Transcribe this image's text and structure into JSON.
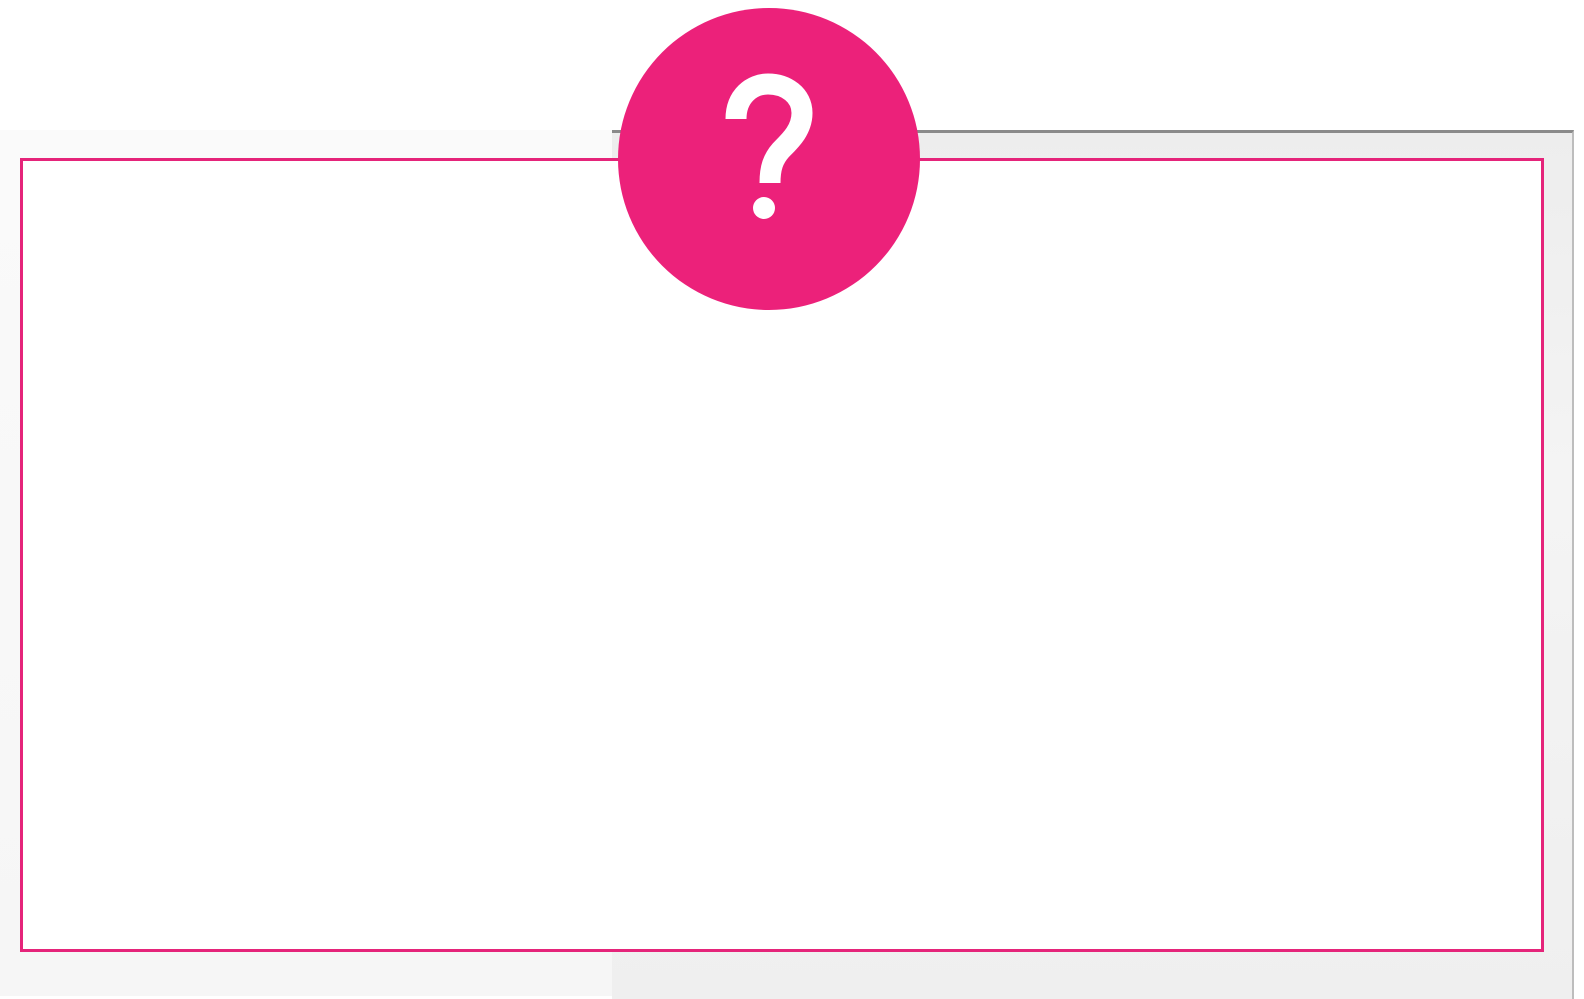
{
  "card": {
    "border_color": "#e5247a",
    "background": "#ffffff"
  },
  "badge": {
    "icon": "question-mark-icon",
    "color": "#ec217a",
    "glyph_color": "#ffffff"
  }
}
